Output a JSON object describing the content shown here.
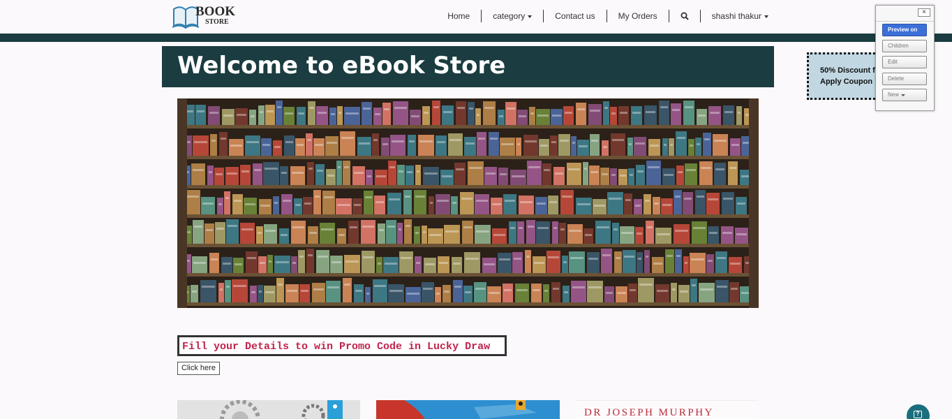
{
  "header": {
    "logo": {
      "word1": "BOOK",
      "word2": "STORE",
      "icon": "open-book-icon"
    },
    "nav": {
      "home": "Home",
      "category": "category",
      "contact": "Contact us",
      "orders": "My Orders",
      "user": "shashi thakur"
    }
  },
  "welcome": {
    "title": "Welcome to eBook Store"
  },
  "hero": {
    "image": "bookshelf-image"
  },
  "promo": {
    "text": "Fill your Details to win Promo Code in Lucky Draw",
    "button": "Click here"
  },
  "books": {
    "third_cover_text": "DR JOSEPH MURPHY"
  },
  "discount": {
    "line1": "50% Discount f",
    "line2": "Apply Coupon"
  },
  "editor": {
    "preview": "Preview on",
    "children": "Children",
    "edit": "Edit",
    "delete": "Delete",
    "new": "New",
    "close": "×"
  },
  "colors": {
    "accent_dark_teal": "#1b3c40",
    "promo_text": "#c0244c",
    "discount_bg": "#c1d8e3",
    "editor_primary": "#3d6fd8"
  }
}
